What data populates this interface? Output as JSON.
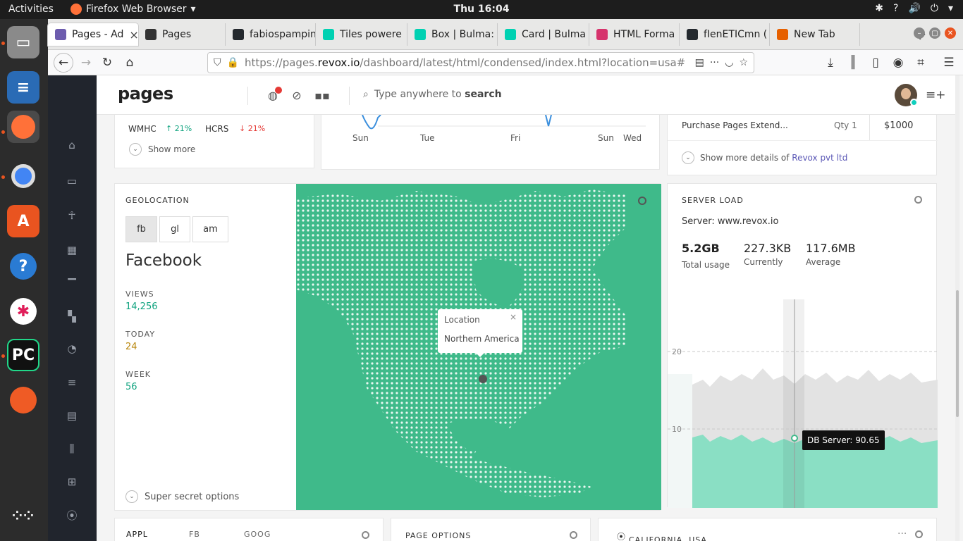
{
  "os": {
    "activities": "Activities",
    "app_name": "Firefox Web Browser",
    "clock": "Thu 16:04"
  },
  "browser": {
    "tabs": [
      {
        "label": "Pages - Ad",
        "color": "#6d5cae",
        "active": true
      },
      {
        "label": "Pages",
        "color": "#333333",
        "active": false
      },
      {
        "label": "fabiospampin",
        "color": "#24292e",
        "active": false
      },
      {
        "label": "Tiles powere",
        "color": "#00d1b2",
        "active": false
      },
      {
        "label": "Box | Bulma:",
        "color": "#00d1b2",
        "active": false
      },
      {
        "label": "Card | Bulma",
        "color": "#00d1b2",
        "active": false
      },
      {
        "label": "HTML Forma",
        "color": "#d6336c",
        "active": false
      },
      {
        "label": "fIenETICmn (",
        "color": "#24292e",
        "active": false
      },
      {
        "label": "New Tab",
        "color": "#e66000",
        "active": false
      }
    ],
    "url_prefix": "https://pages.",
    "url_host": "revox.io",
    "url_path": "/dashboard/latest/html/condensed/index.html?location=usa#"
  },
  "header": {
    "logo": "pages",
    "search_placeholder": "Type anywhere to ",
    "search_bold": "search"
  },
  "top_left": {
    "metric_a": "WMHC",
    "metric_a_change": "21%",
    "metric_b": "HCRS",
    "metric_b_change": "21%",
    "show_more": "Show more",
    "up_color": "#10a37f",
    "down_color": "#e53935"
  },
  "top_mid": {
    "x_labels": [
      "Sun",
      "Tue",
      "Fri",
      "Sun",
      "Wed"
    ]
  },
  "top_right": {
    "item": "Purchase Pages Extend...",
    "qty": "Qty 1",
    "price": "$1000",
    "details_prefix": "Show more details of ",
    "details_link": "Revox pvt ltd"
  },
  "geolocation": {
    "label": "GEOLOCATION",
    "segments": [
      "fb",
      "gl",
      "am"
    ],
    "title": "Facebook",
    "stats": [
      {
        "label": "VIEWS",
        "value": "14,256",
        "color": "#10a37f"
      },
      {
        "label": "TODAY",
        "value": "24",
        "color": "#b8860b"
      },
      {
        "label": "WEEK",
        "value": "56",
        "color": "#10a37f"
      }
    ],
    "footer": "Super secret options",
    "popup_title": "Location",
    "popup_text": "Northern America"
  },
  "server_load": {
    "label": "SERVER LOAD",
    "server": "Server: www.revox.io",
    "metrics": [
      {
        "value": "5.2GB",
        "caption": "Total usage"
      },
      {
        "value": "227.3KB",
        "caption": "Currently"
      },
      {
        "value": "117.6MB",
        "caption": "Average"
      }
    ],
    "y_ticks": [
      "20",
      "10"
    ],
    "tooltip": "DB Server: 90.65"
  },
  "bottom": {
    "stocks": [
      "APPL",
      "FB",
      "GOOG"
    ],
    "page_options": "PAGE OPTIONS",
    "location": "CALIFORNIA, USA"
  }
}
